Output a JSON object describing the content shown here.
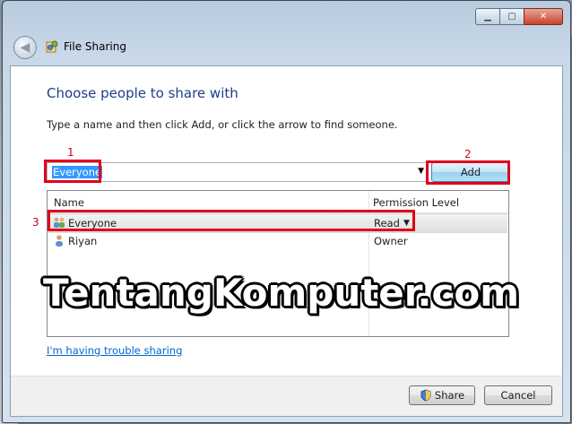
{
  "window": {
    "title": "File Sharing"
  },
  "content": {
    "heading": "Choose people to share with",
    "instruction": "Type a name and then click Add, or click the arrow to find someone.",
    "name_input_value": "Everyone",
    "add_label": "Add",
    "trouble_link": "I'm having trouble sharing"
  },
  "list": {
    "columns": [
      "Name",
      "Permission Level"
    ],
    "rows": [
      {
        "name": "Everyone",
        "permission": "Read",
        "icon": "group-users-icon"
      },
      {
        "name": "Riyan",
        "permission": "Owner",
        "icon": "user-icon"
      }
    ]
  },
  "footer": {
    "share_label": "Share",
    "cancel_label": "Cancel"
  },
  "annotations": [
    "1",
    "2",
    "3"
  ],
  "watermark": "TentangKomputer.com",
  "colors": {
    "heading": "#1c3d8c",
    "link": "#0066cc",
    "annotation": "#e0001b",
    "selection": "#3399ff"
  }
}
